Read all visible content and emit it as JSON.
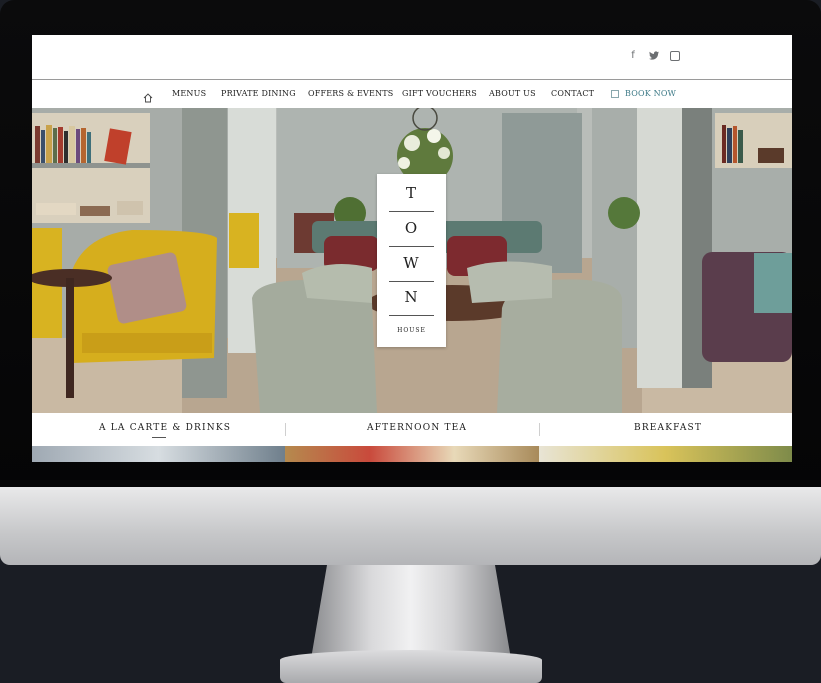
{
  "social": {
    "facebook": "f",
    "twitter": "🐦",
    "instagram_icon": "instagram-icon"
  },
  "nav": {
    "home_icon": "home-icon",
    "items": [
      "MENUS",
      "PRIVATE DINING",
      "OFFERS & EVENTS",
      "GIFT VOUCHERS",
      "ABOUT US",
      "CONTACT"
    ],
    "book_now": "BOOK NOW",
    "book_icon": "calendar-icon"
  },
  "logo": {
    "letters": [
      "T",
      "O",
      "W",
      "N"
    ],
    "subtitle": "HOUSE"
  },
  "tabs": [
    "A LA CARTE & DRINKS",
    "AFTERNOON TEA",
    "BREAKFAST"
  ],
  "colors": {
    "accent": "#3f7b88",
    "nav_text": "#1d1d1d",
    "bezel": "#0b0b0c"
  }
}
